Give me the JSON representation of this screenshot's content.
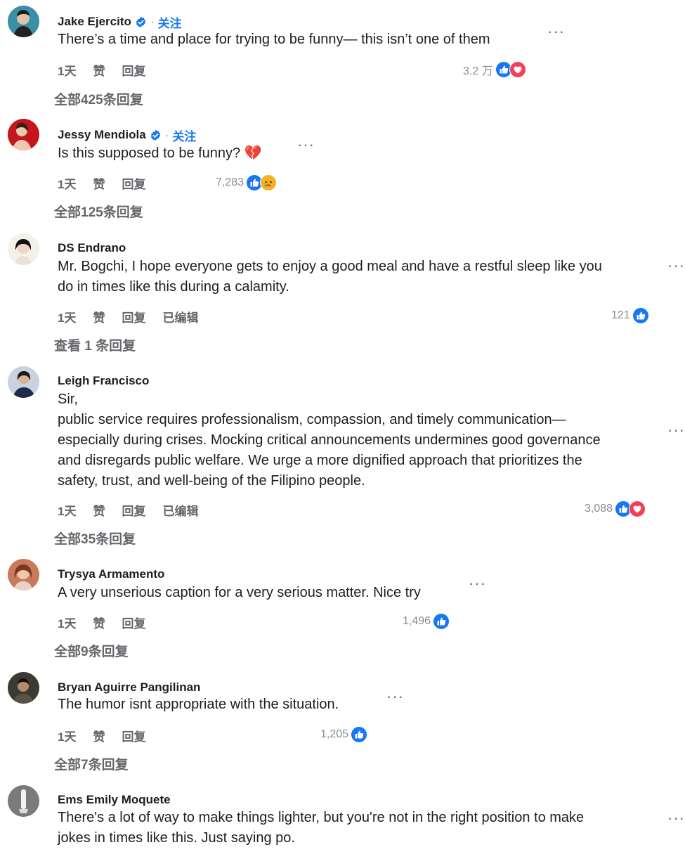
{
  "comments": [
    {
      "name": "Jake Ejercito",
      "verified": true,
      "follow_label": "关注",
      "text_lines": [
        "There’s a time and place for trying to be funny— this isn’t one of them"
      ],
      "time": "1天",
      "like": "赞",
      "reply": "回复",
      "edited": "",
      "reaction_count": "3.2 万",
      "reactions": [
        "like-icon",
        "love-icon"
      ],
      "replies_label": "全部425条回复"
    },
    {
      "name": "Jessy Mendiola",
      "verified": true,
      "follow_label": "关注",
      "text_lines": [
        "Is this supposed to be funny? 💔"
      ],
      "time": "1天",
      "like": "赞",
      "reply": "回复",
      "edited": "",
      "reaction_count": "7,283",
      "reactions": [
        "like-icon",
        "sad-icon"
      ],
      "replies_label": "全部125条回复"
    },
    {
      "name": "DS Endrano",
      "verified": false,
      "follow_label": "",
      "text_lines": [
        "Mr. Bogchi, I hope everyone gets to enjoy a good meal and have a restful sleep like you",
        "do in times like this during a calamity."
      ],
      "time": "1天",
      "like": "赞",
      "reply": "回复",
      "edited": "已编辑",
      "reaction_count": "121",
      "reactions": [
        "like-icon"
      ],
      "replies_label": "查看 1 条回复"
    },
    {
      "name": "Leigh Francisco",
      "verified": false,
      "follow_label": "",
      "text_lines": [
        "Sir,",
        "public service requires professionalism, compassion, and timely communication—",
        "especially during crises. Mocking critical announcements undermines good governance",
        "and disregards public welfare. We urge a more dignified approach that prioritizes the",
        "safety, trust, and well-being of the Filipino people."
      ],
      "time": "1天",
      "like": "赞",
      "reply": "回复",
      "edited": "已编辑",
      "reaction_count": "3,088",
      "reactions": [
        "like-icon",
        "love-icon"
      ],
      "replies_label": "全部35条回复"
    },
    {
      "name": "Trysya Armamento",
      "verified": false,
      "follow_label": "",
      "text_lines": [
        "A very unserious caption for a very serious matter. Nice try"
      ],
      "time": "1天",
      "like": "赞",
      "reply": "回复",
      "edited": "",
      "reaction_count": "1,496",
      "reactions": [
        "like-icon"
      ],
      "replies_label": "全部9条回复"
    },
    {
      "name": "Bryan Aguirre Pangilinan",
      "verified": false,
      "follow_label": "",
      "text_lines": [
        "The humor isnt appropriate with the situation."
      ],
      "time": "1天",
      "like": "赞",
      "reply": "回复",
      "edited": "",
      "reaction_count": "1,205",
      "reactions": [
        "like-icon"
      ],
      "replies_label": "全部7条回复"
    },
    {
      "name": "Ems Emily Moquete",
      "verified": false,
      "follow_label": "",
      "text_lines": [
        "There's a lot of way to make things lighter, but you're not in the right position to make",
        "jokes in times like this. Just saying po."
      ],
      "time": "",
      "like": "",
      "reply": "",
      "edited": "",
      "reaction_count": "",
      "reactions": [],
      "replies_label": ""
    }
  ],
  "more_label": "···",
  "name_separator": "·",
  "colors": {
    "accent": "#1877f2",
    "like": "#1877f2",
    "love": "#f33e58",
    "sad": "#f7b125",
    "muted": "#65676b"
  }
}
